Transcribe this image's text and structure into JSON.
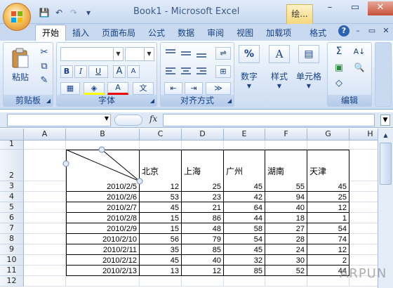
{
  "title": "Book1 - Microsoft Excel",
  "context_tab": "绘...",
  "window_controls": [
    "–",
    "▭",
    "✕"
  ],
  "qat": {
    "save": "💾",
    "undo": "↶",
    "redo": "↷",
    "customize": "▾"
  },
  "tabs": [
    "开始",
    "插入",
    "页面布局",
    "公式",
    "数据",
    "审阅",
    "视图",
    "加载项",
    "格式"
  ],
  "active_tab": "开始",
  "ribbon_right": {
    "help": "?",
    "min": "–",
    "restore": "▭",
    "close": "✕"
  },
  "groups": {
    "clipboard": {
      "label": "剪贴板",
      "paste": "粘贴",
      "cut": "✂",
      "copy": "⧉",
      "format_painter": "✎"
    },
    "font": {
      "label": "字体",
      "bold": "B",
      "italic": "I",
      "underline": "U",
      "grow": "A",
      "shrink": "A",
      "border": "▦",
      "fill": "◈",
      "color": "A",
      "phonetic": "文"
    },
    "alignment": {
      "label": "对齐方式",
      "wrap": "⇌",
      "merge": "⊞",
      "orient": "≫"
    },
    "number": {
      "label": "数字",
      "icon": "%"
    },
    "style": {
      "label": "样式",
      "icon": "A"
    },
    "cells": {
      "label": "单元格",
      "icon": "▤"
    },
    "editing": {
      "label": "编辑",
      "sum": "Σ",
      "sort": "A↓",
      "find": "🔍",
      "clear": "◇"
    }
  },
  "formula_bar": {
    "name_box": "",
    "fx": "fx",
    "value": ""
  },
  "columns": [
    "A",
    "B",
    "C",
    "D",
    "E",
    "F",
    "G",
    "H"
  ],
  "rows": [
    "1",
    "2",
    "3",
    "4",
    "5",
    "6",
    "7",
    "8",
    "9",
    "10",
    "11",
    "12"
  ],
  "table": {
    "headers": [
      "北京",
      "上海",
      "广州",
      "湖南",
      "天津"
    ],
    "records": [
      {
        "date": "2010/2/5",
        "values": [
          "12",
          "25",
          "45",
          "55",
          "45"
        ]
      },
      {
        "date": "2010/2/6",
        "values": [
          "53",
          "23",
          "42",
          "94",
          "25"
        ]
      },
      {
        "date": "2010/2/7",
        "values": [
          "45",
          "21",
          "64",
          "40",
          "12"
        ]
      },
      {
        "date": "2010/2/8",
        "values": [
          "15",
          "86",
          "44",
          "18",
          "1"
        ]
      },
      {
        "date": "2010/2/9",
        "values": [
          "15",
          "48",
          "58",
          "27",
          "54"
        ]
      },
      {
        "date": "2010/2/10",
        "values": [
          "56",
          "79",
          "54",
          "28",
          "74"
        ]
      },
      {
        "date": "2010/2/11",
        "values": [
          "35",
          "85",
          "45",
          "24",
          "12"
        ]
      },
      {
        "date": "2010/2/12",
        "values": [
          "45",
          "40",
          "32",
          "30",
          "2"
        ]
      },
      {
        "date": "2010/2/13",
        "values": [
          "13",
          "12",
          "85",
          "52",
          "44"
        ]
      }
    ]
  },
  "watermark": "ARPUN",
  "colors": {
    "ribbon": "#dbe7f7",
    "grid_line": "#d8dfe8",
    "header": "#d6e2f2"
  }
}
